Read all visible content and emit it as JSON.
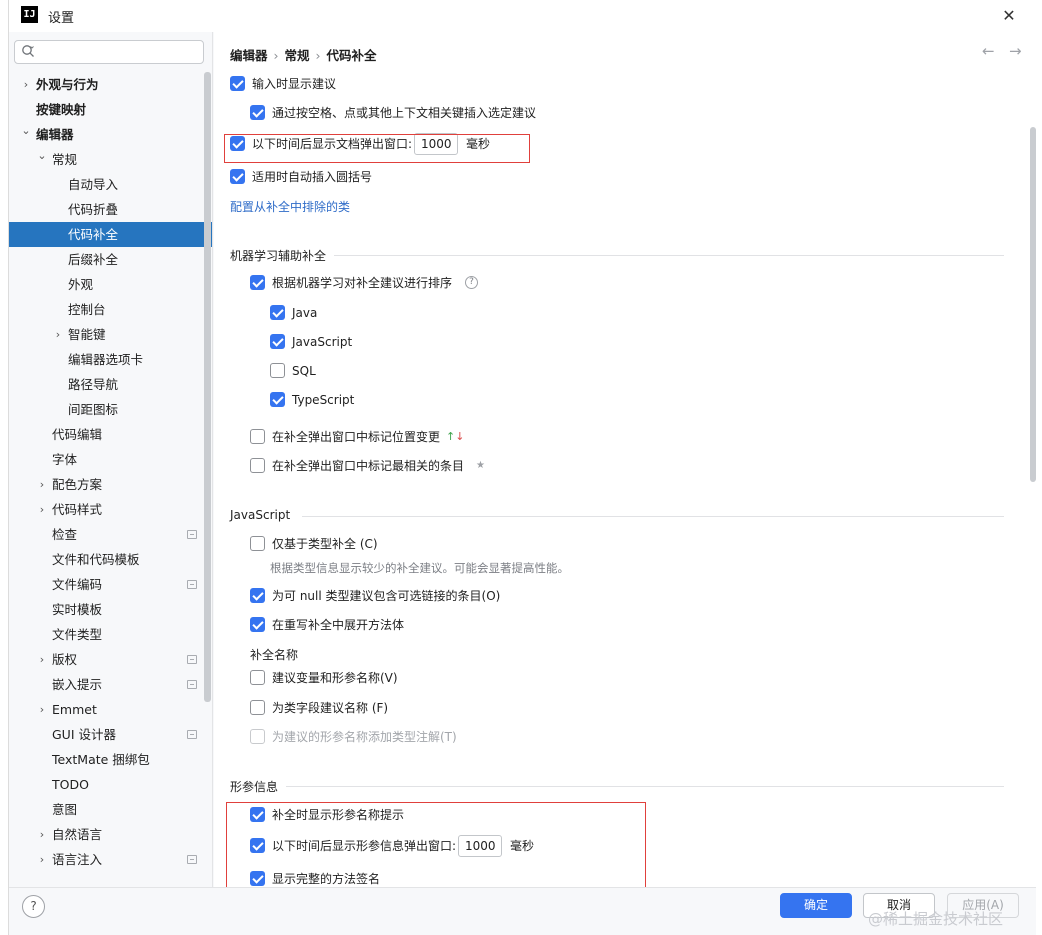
{
  "window": {
    "title": "设置",
    "close_glyph": "✕",
    "logo_text": "IJ"
  },
  "sidebar": {
    "search": {
      "placeholder": "",
      "value": ""
    },
    "items": [
      {
        "label": "外观与行为",
        "bold": true,
        "expand": "right"
      },
      {
        "label": "按键映射",
        "bold": true,
        "expand": ""
      },
      {
        "label": "编辑器",
        "bold": true,
        "expand": "down"
      },
      {
        "label": "常规",
        "bold": false,
        "expand": "down"
      },
      {
        "label": "自动导入"
      },
      {
        "label": "代码折叠"
      },
      {
        "label": "代码补全",
        "selected": true
      },
      {
        "label": "后缀补全"
      },
      {
        "label": "外观"
      },
      {
        "label": "控制台"
      },
      {
        "label": "智能键",
        "expand": "right"
      },
      {
        "label": "编辑器选项卡"
      },
      {
        "label": "路径导航"
      },
      {
        "label": "间距图标"
      },
      {
        "label": "代码编辑"
      },
      {
        "label": "字体"
      },
      {
        "label": "配色方案",
        "expand": "right"
      },
      {
        "label": "代码样式",
        "expand": "right"
      },
      {
        "label": "检查",
        "project": true
      },
      {
        "label": "文件和代码模板"
      },
      {
        "label": "文件编码",
        "project": true
      },
      {
        "label": "实时模板"
      },
      {
        "label": "文件类型"
      },
      {
        "label": "版权",
        "expand": "right",
        "project": true
      },
      {
        "label": "嵌入提示",
        "project": true
      },
      {
        "label": "Emmet",
        "expand": "right"
      },
      {
        "label": "GUI 设计器",
        "project": true
      },
      {
        "label": "TextMate 捆绑包"
      },
      {
        "label": "TODO"
      },
      {
        "label": "意图"
      },
      {
        "label": "自然语言",
        "expand": "right"
      },
      {
        "label": "语言注入",
        "expand": "right",
        "project": true
      }
    ]
  },
  "breadcrumb": {
    "parts": [
      "编辑器",
      "常规",
      "代码补全"
    ],
    "sep": "›"
  },
  "nav": {
    "back": "←",
    "forward": "→"
  },
  "options": {
    "show_suggestions": {
      "label": "输入时显示建议",
      "checked": true
    },
    "insert_with_keys": {
      "label": "通过按空格、点或其他上下文相关键插入选定建议",
      "checked": true
    },
    "doc_popup": {
      "label": "以下时间后显示文档弹出窗口:",
      "checked": true,
      "value": "1000",
      "suffix": "毫秒"
    },
    "auto_parens": {
      "label": "适用时自动插入圆括号",
      "checked": true
    },
    "exclude_link": "配置从补全中排除的类"
  },
  "ml": {
    "title": "机器学习辅助补全",
    "sort": {
      "label": "根据机器学习对补全建议进行排序",
      "checked": true,
      "help": "?"
    },
    "languages": [
      {
        "label": "Java",
        "checked": true
      },
      {
        "label": "JavaScript",
        "checked": true
      },
      {
        "label": "SQL",
        "checked": false
      },
      {
        "label": "TypeScript",
        "checked": true
      }
    ],
    "mark_position": {
      "label": "在补全弹出窗口中标记位置变更",
      "checked": false,
      "up": "↑",
      "down": "↓"
    },
    "mark_relevant": {
      "label": "在补全弹出窗口中标记最相关的条目",
      "checked": false,
      "star": "★"
    }
  },
  "javascript": {
    "title": "JavaScript",
    "type_based": {
      "label": "仅基于类型补全 (C)",
      "checked": false,
      "hint": "根据类型信息显示较少的补全建议。可能会显著提高性能。"
    },
    "nullable": {
      "label": "为可 null 类型建议包含可选链接的条目(O)",
      "checked": true
    },
    "expand_method": {
      "label": "在重写补全中展开方法体",
      "checked": true
    },
    "naming_title": "补全名称",
    "var_names": {
      "label": "建议变量和形参名称(V)",
      "checked": false
    },
    "field_names": {
      "label": "为类字段建议名称 (F)",
      "checked": false
    },
    "type_annot": {
      "label": "为建议的形参名称添加类型注解(T)",
      "checked": false,
      "disabled": true
    }
  },
  "params": {
    "title": "形参信息",
    "show_hints": {
      "label": "补全时显示形参名称提示",
      "checked": true
    },
    "popup": {
      "label": "以下时间后显示形参信息弹出窗口:",
      "checked": true,
      "value": "1000",
      "suffix": "毫秒"
    },
    "full_signature": {
      "label": "显示完整的方法签名",
      "checked": true
    }
  },
  "footer": {
    "help": "?",
    "ok": "确定",
    "cancel": "取消",
    "apply": "应用(A)"
  },
  "watermark": "@稀土掘金技术社区",
  "colors": {
    "accent": "#3574f0",
    "selected": "#2675bf",
    "highlight": "#e0403c",
    "link": "#2f6cc8"
  }
}
